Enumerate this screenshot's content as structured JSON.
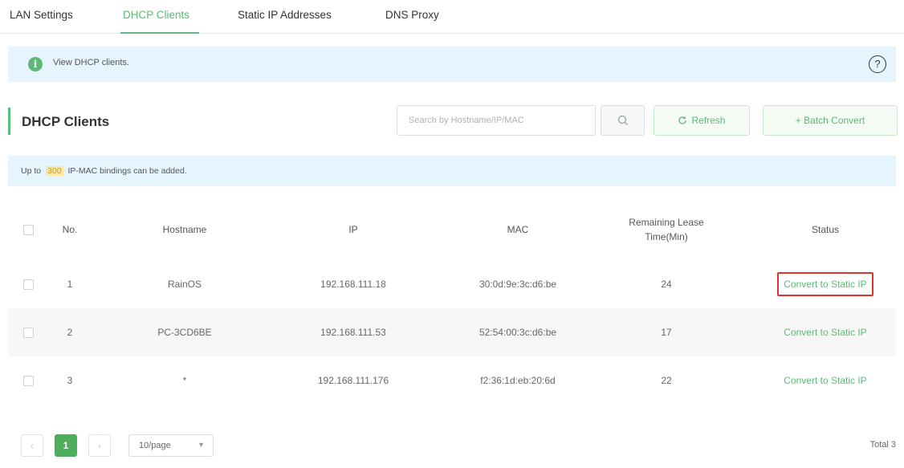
{
  "tabs": [
    {
      "label": "LAN Settings",
      "active": false
    },
    {
      "label": "DHCP Clients",
      "active": true
    },
    {
      "label": "Static IP Addresses",
      "active": false
    },
    {
      "label": "DNS Proxy",
      "active": false
    }
  ],
  "info": {
    "icon": "info-icon",
    "text": "View DHCP clients.",
    "help_icon": "question-circle-icon"
  },
  "section": {
    "title": "DHCP Clients",
    "search_placeholder": "Search by Hostname/IP/MAC",
    "refresh_label": "Refresh",
    "batch_convert_label": "+ Batch Convert"
  },
  "note": {
    "prefix": "Up to",
    "count": "300",
    "suffix": "IP-MAC bindings can be added."
  },
  "table": {
    "columns": [
      "No.",
      "Hostname",
      "IP",
      "MAC",
      "Remaining Lease Time(Min)",
      "Status"
    ],
    "rows": [
      {
        "no": "1",
        "hostname": "RainOS",
        "ip": "192.168.111.18",
        "mac": "30:0d:9e:3c:d6:be",
        "lease": "24",
        "status": "Convert to Static IP",
        "highlighted": true
      },
      {
        "no": "2",
        "hostname": "PC-3CD6BE",
        "ip": "192.168.111.53",
        "mac": "52:54:00:3c:d6:be",
        "lease": "17",
        "status": "Convert to Static IP",
        "highlighted": false
      },
      {
        "no": "3",
        "hostname": "*",
        "ip": "192.168.111.176",
        "mac": "f2:36:1d:eb:20:6d",
        "lease": "22",
        "status": "Convert to Static IP",
        "highlighted": false
      }
    ]
  },
  "pagination": {
    "current_page": "1",
    "page_size": "10/page",
    "total": "Total 3"
  },
  "colors": {
    "accent": "#5fb878",
    "info_bg": "#e6f4fd",
    "highlight_border": "#e03030"
  }
}
